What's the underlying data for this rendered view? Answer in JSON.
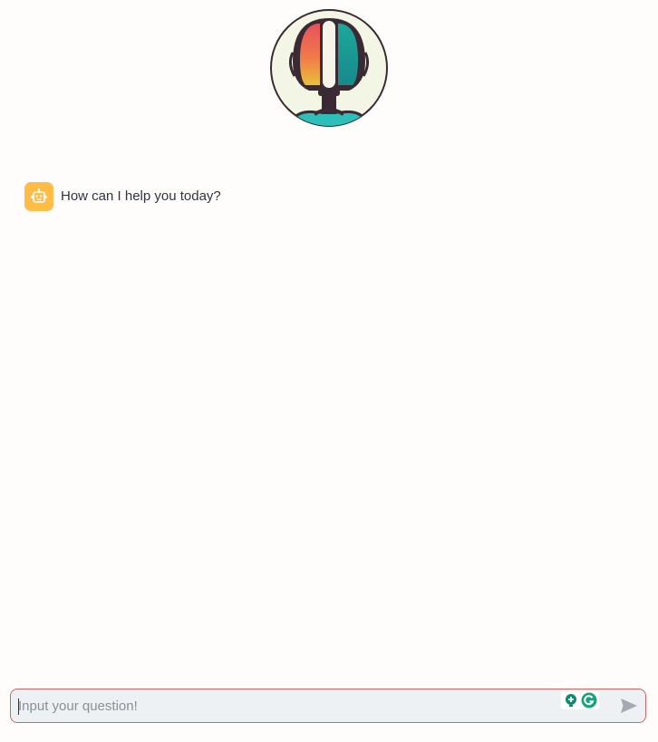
{
  "header": {
    "logo_icon": "robot-head-logo-icon"
  },
  "chat": {
    "messages": [
      {
        "role": "assistant",
        "avatar_icon": "robot-face-icon",
        "avatar_color": "#ffbd45",
        "text": "How can I help you today?"
      }
    ]
  },
  "input": {
    "placeholder": "Input your question!",
    "value": "",
    "border_color": "#e06062",
    "send_icon": "send-arrow-icon",
    "extension_icons": [
      "lightbulb-extension-icon",
      "grammarly-icon"
    ]
  },
  "colors": {
    "background": "#fffdfb",
    "accent_red": "#e06062",
    "avatar": "#ffbd45"
  }
}
